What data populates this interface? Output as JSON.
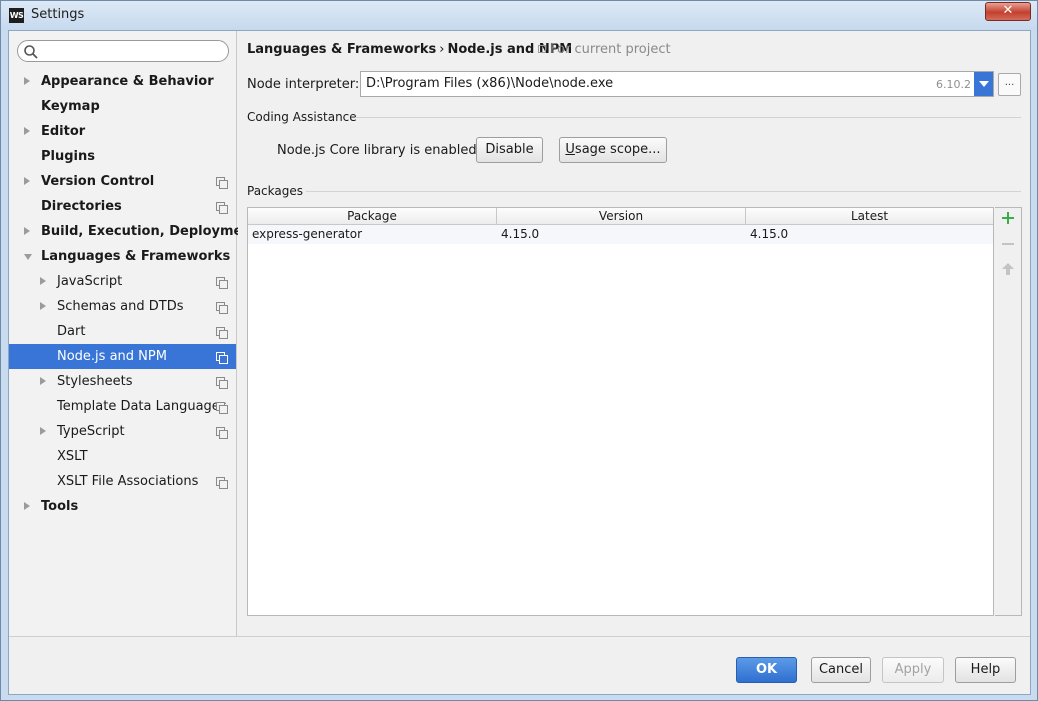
{
  "window": {
    "title": "Settings",
    "app_icon_text": "WS",
    "close_label": "✕"
  },
  "sidebar": {
    "search": {
      "value": "",
      "placeholder": ""
    },
    "items": [
      {
        "label": "Appearance & Behavior",
        "level": 1,
        "arrow": "right",
        "project_icon": false
      },
      {
        "label": "Keymap",
        "level": 1,
        "arrow": "none",
        "project_icon": false
      },
      {
        "label": "Editor",
        "level": 1,
        "arrow": "right",
        "project_icon": false
      },
      {
        "label": "Plugins",
        "level": 1,
        "arrow": "none",
        "project_icon": false
      },
      {
        "label": "Version Control",
        "level": 1,
        "arrow": "right",
        "project_icon": true
      },
      {
        "label": "Directories",
        "level": 1,
        "arrow": "none",
        "project_icon": true
      },
      {
        "label": "Build, Execution, Deployment",
        "level": 1,
        "arrow": "right",
        "project_icon": false
      },
      {
        "label": "Languages & Frameworks",
        "level": 1,
        "arrow": "down",
        "project_icon": false
      },
      {
        "label": "JavaScript",
        "level": 2,
        "arrow": "right",
        "project_icon": true
      },
      {
        "label": "Schemas and DTDs",
        "level": 2,
        "arrow": "right",
        "project_icon": true
      },
      {
        "label": "Dart",
        "level": 2,
        "arrow": "none",
        "project_icon": true
      },
      {
        "label": "Node.js and NPM",
        "level": 2,
        "arrow": "none",
        "project_icon": true,
        "selected": true
      },
      {
        "label": "Stylesheets",
        "level": 2,
        "arrow": "right",
        "project_icon": true
      },
      {
        "label": "Template Data Languages",
        "level": 2,
        "arrow": "none",
        "project_icon": true
      },
      {
        "label": "TypeScript",
        "level": 2,
        "arrow": "right",
        "project_icon": true
      },
      {
        "label": "XSLT",
        "level": 2,
        "arrow": "none",
        "project_icon": false
      },
      {
        "label": "XSLT File Associations",
        "level": 2,
        "arrow": "none",
        "project_icon": true
      },
      {
        "label": "Tools",
        "level": 1,
        "arrow": "right",
        "project_icon": false
      }
    ]
  },
  "main": {
    "breadcrumb": {
      "parent": "Languages & Frameworks",
      "separator": "›",
      "current": "Node.js and NPM"
    },
    "for_current_project": "For current project",
    "node_interpreter": {
      "label": "Node interpreter:",
      "value": "D:\\Program Files (x86)\\Node\\node.exe",
      "version": "6.10.2",
      "browse_label": "..."
    },
    "coding_assistance": {
      "title": "Coding Assistance",
      "status_text": "Node.js Core library is enabled.",
      "disable_label": "Disable",
      "usage_scope_mnemonic": "U",
      "usage_scope_rest": "sage scope..."
    },
    "packages": {
      "title": "Packages",
      "columns": [
        "Package",
        "Version",
        "Latest"
      ],
      "rows": [
        {
          "package": "express-generator",
          "version": "4.15.0",
          "latest": "4.15.0"
        }
      ]
    }
  },
  "footer": {
    "ok_label": "OK",
    "cancel_label": "Cancel",
    "apply_label": "Apply",
    "help_label": "Help"
  },
  "colors": {
    "selection": "#3875d7",
    "ok_button": "#2f6fd0",
    "add_icon": "#3bad47"
  }
}
